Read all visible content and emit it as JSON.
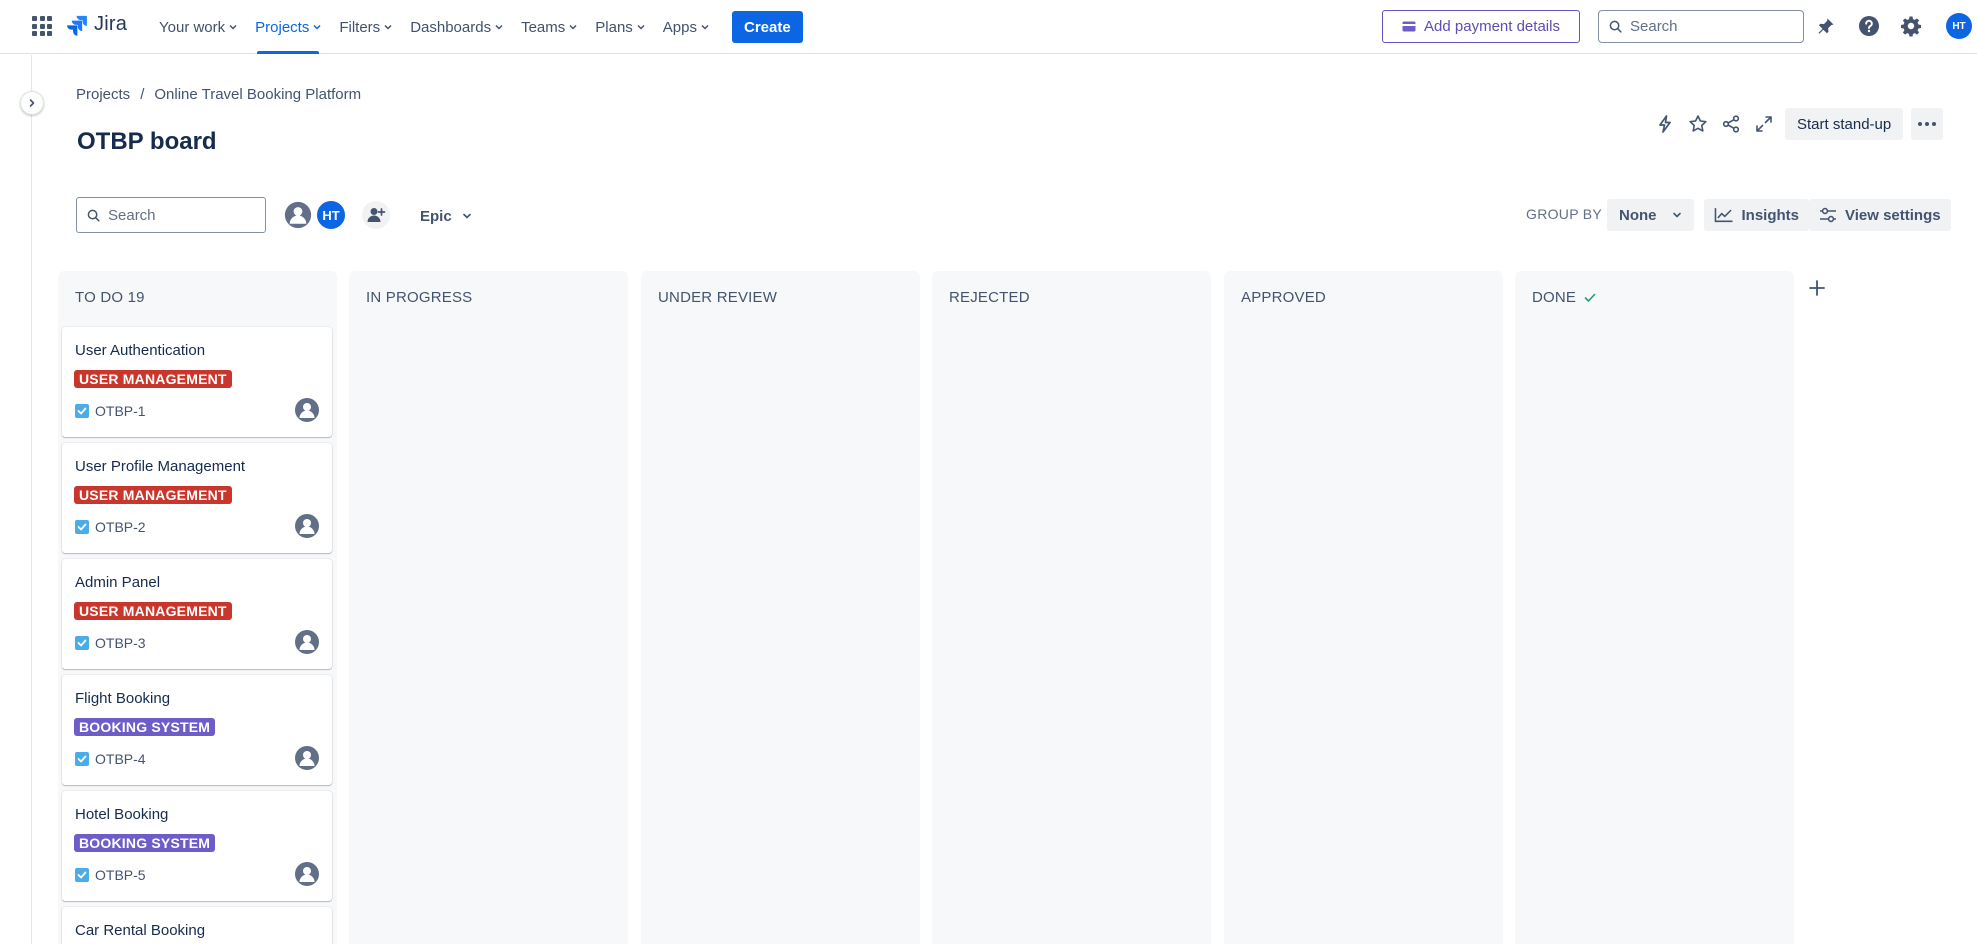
{
  "app": {
    "name": "Jira"
  },
  "nav": {
    "items": [
      {
        "label": "Your work",
        "active": false
      },
      {
        "label": "Projects",
        "active": true
      },
      {
        "label": "Filters",
        "active": false
      },
      {
        "label": "Dashboards",
        "active": false
      },
      {
        "label": "Teams",
        "active": false
      },
      {
        "label": "Plans",
        "active": false
      },
      {
        "label": "Apps",
        "active": false
      }
    ],
    "create_label": "Create",
    "payment_label": "Add payment details",
    "search_placeholder": "Search",
    "user_initials": "HT"
  },
  "breadcrumb": {
    "root": "Projects",
    "separator": "/",
    "project": "Online Travel Booking Platform"
  },
  "page": {
    "title": "OTBP board"
  },
  "header_actions": {
    "standup_label": "Start stand-up"
  },
  "toolbar": {
    "search_placeholder": "Search",
    "avatar_initials": "HT",
    "epic_label": "Epic",
    "groupby_label": "GROUP BY",
    "groupby_value": "None",
    "insights_label": "Insights",
    "view_settings_label": "View settings"
  },
  "columns": [
    {
      "title": "TO DO 19"
    },
    {
      "title": "IN PROGRESS"
    },
    {
      "title": "UNDER REVIEW"
    },
    {
      "title": "REJECTED"
    },
    {
      "title": "APPROVED"
    },
    {
      "title": "DONE"
    }
  ],
  "cards": [
    {
      "title": "User Authentication",
      "epic": "USER MANAGEMENT",
      "key": "OTBP-1"
    },
    {
      "title": "User Profile Management",
      "epic": "USER MANAGEMENT",
      "key": "OTBP-2"
    },
    {
      "title": "Admin Panel",
      "epic": "USER MANAGEMENT",
      "key": "OTBP-3"
    },
    {
      "title": "Flight Booking",
      "epic": "BOOKING SYSTEM",
      "key": "OTBP-4"
    },
    {
      "title": "Hotel Booking",
      "epic": "BOOKING SYSTEM",
      "key": "OTBP-5"
    },
    {
      "title": "Car Rental Booking"
    }
  ],
  "colors": {
    "accent": "#0c66e4",
    "epic_user_management": "#c9372c",
    "epic_booking_system": "#6e5dc6",
    "done_check": "#22a06b"
  }
}
